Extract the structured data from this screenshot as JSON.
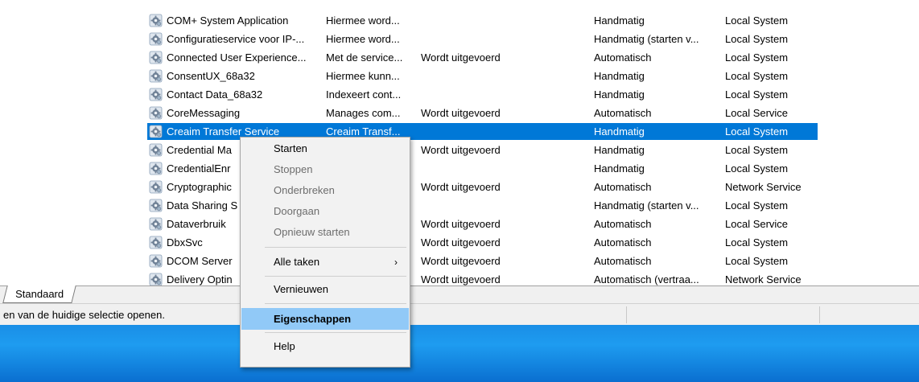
{
  "services": [
    {
      "name": "COM+ System Application",
      "description": "Hiermee word...",
      "status": "",
      "startup": "Handmatig",
      "logon": "Local System"
    },
    {
      "name": "Configuratieservice voor IP-...",
      "description": "Hiermee word...",
      "status": "",
      "startup": "Handmatig (starten v...",
      "logon": "Local System"
    },
    {
      "name": "Connected User Experience...",
      "description": "Met de service...",
      "status": "Wordt uitgevoerd",
      "startup": "Automatisch",
      "logon": "Local System"
    },
    {
      "name": "ConsentUX_68a32",
      "description": "Hiermee kunn...",
      "status": "",
      "startup": "Handmatig",
      "logon": "Local System"
    },
    {
      "name": "Contact Data_68a32",
      "description": "Indexeert cont...",
      "status": "",
      "startup": "Handmatig",
      "logon": "Local System"
    },
    {
      "name": "CoreMessaging",
      "description": "Manages com...",
      "status": "Wordt uitgevoerd",
      "startup": "Automatisch",
      "logon": "Local Service"
    },
    {
      "name": "Creaim Transfer Service",
      "description": "Creaim Transf...",
      "status": "",
      "startup": "Handmatig",
      "logon": "Local System"
    },
    {
      "name": "Credential Ma",
      "description": "",
      "status": "Wordt uitgevoerd",
      "startup": "Handmatig",
      "logon": "Local System"
    },
    {
      "name": "CredentialEnr",
      "description": "",
      "status": "",
      "startup": "Handmatig",
      "logon": "Local System"
    },
    {
      "name": "Cryptographic",
      "description": "",
      "status": "Wordt uitgevoerd",
      "startup": "Automatisch",
      "logon": "Network Service"
    },
    {
      "name": "Data Sharing S",
      "description": "",
      "status": "",
      "startup": "Handmatig (starten v...",
      "logon": "Local System"
    },
    {
      "name": "Dataverbruik",
      "description": "",
      "status": "Wordt uitgevoerd",
      "startup": "Automatisch",
      "logon": "Local Service"
    },
    {
      "name": "DbxSvc",
      "description": "",
      "status": "Wordt uitgevoerd",
      "startup": "Automatisch",
      "logon": "Local System"
    },
    {
      "name": "DCOM Server",
      "description": "",
      "status": "Wordt uitgevoerd",
      "startup": "Automatisch",
      "logon": "Local System"
    },
    {
      "name": "Delivery Optin",
      "description": "",
      "status": "Wordt uitgevoerd",
      "startup": "Automatisch (vertraa...",
      "logon": "Network Service"
    }
  ],
  "selected_service": "Creaim Transfer Service",
  "icon": "gear-service-icon",
  "tabs": [
    {
      "label": "Standaard"
    }
  ],
  "statusbar": {
    "text": "en van de huidige selectie openen."
  },
  "context_menu": {
    "items": [
      {
        "label": "Starten",
        "enabled": true
      },
      {
        "label": "Stoppen",
        "enabled": false
      },
      {
        "label": "Onderbreken",
        "enabled": false
      },
      {
        "label": "Doorgaan",
        "enabled": false
      },
      {
        "label": "Opnieuw starten",
        "enabled": false
      },
      {
        "label": "Alle taken",
        "enabled": true,
        "submenu": true,
        "arrow": "›"
      },
      {
        "label": "Vernieuwen",
        "enabled": true
      },
      {
        "label": "Eigenschappen",
        "enabled": true,
        "bold": true,
        "highlighted": true
      },
      {
        "label": "Help",
        "enabled": true
      }
    ]
  },
  "colors": {
    "selection": "#0078d7",
    "menu_highlight": "#91c9f7",
    "desktop": "#1e9cf0"
  }
}
